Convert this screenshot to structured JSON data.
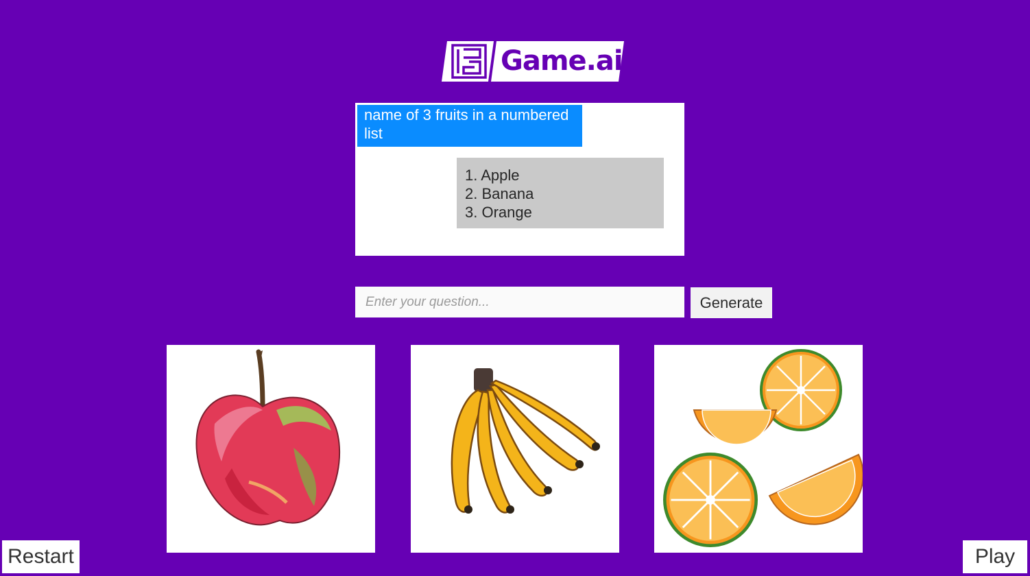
{
  "brand": {
    "name": "Game.ai"
  },
  "chat": {
    "user_message": "name of 3 fruits in a numbered list",
    "ai_response_lines": [
      "1. Apple",
      "2. Banana",
      "3. Orange"
    ]
  },
  "input": {
    "placeholder": "Enter your question...",
    "value": ""
  },
  "generate_label": "Generate",
  "images": [
    {
      "subject": "apple",
      "icon": "apple-illustration"
    },
    {
      "subject": "banana",
      "icon": "banana-bunch-illustration"
    },
    {
      "subject": "orange",
      "icon": "orange-slices-illustration"
    }
  ],
  "controls": {
    "restart_label": "Restart",
    "play_label": "Play"
  },
  "colors": {
    "background": "#6600b4",
    "user_bubble": "#0a8cff",
    "ai_bubble": "#c9c9c9",
    "brand_text": "#6600b4"
  }
}
